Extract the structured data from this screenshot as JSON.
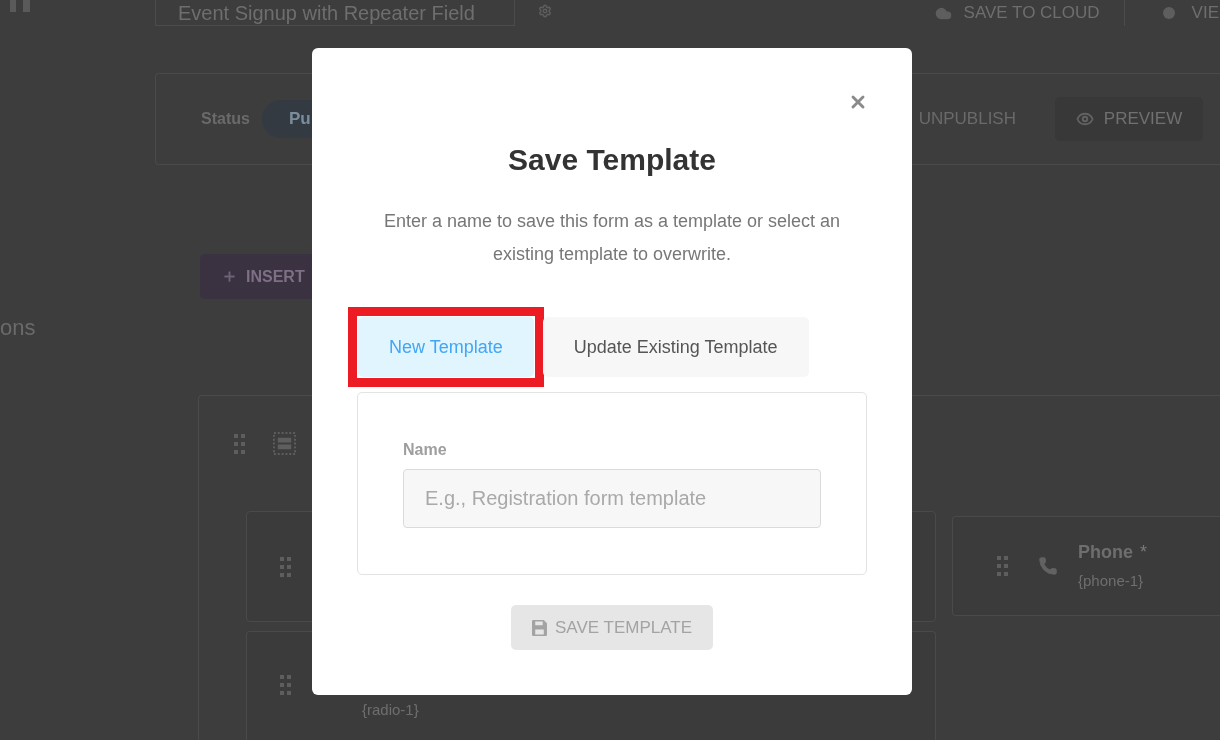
{
  "header": {
    "form_title": "Event Signup with Repeater Field",
    "save_to_cloud": "SAVE TO CLOUD",
    "view": "VIE"
  },
  "publish_bar": {
    "status_label": "Status",
    "status": "Pu",
    "unpublish": "UNPUBLISH",
    "preview": "PREVIEW"
  },
  "insert_button": "INSERT",
  "side_panel": {
    "heading": "ons"
  },
  "form_canvas": {
    "left_column": [
      {
        "kind": "radio",
        "tag": "{radio-1}"
      }
    ],
    "right_column": [
      {
        "kind": "phone",
        "label": "Phone",
        "required_mark": "*",
        "tag": "{phone-1}"
      }
    ]
  },
  "dialog": {
    "title": "Save Template",
    "description": "Enter a name to save this form as a template or select an existing template to overwrite.",
    "tabs": [
      {
        "label": "New Template",
        "selected": true,
        "highlighted": true
      },
      {
        "label": "Update Existing Template",
        "selected": false,
        "highlighted": false
      }
    ],
    "name_field": {
      "label": "Name",
      "placeholder": "E.g., Registration form template"
    },
    "save_button": {
      "label": "SAVE TEMPLATE",
      "disabled": true
    }
  }
}
